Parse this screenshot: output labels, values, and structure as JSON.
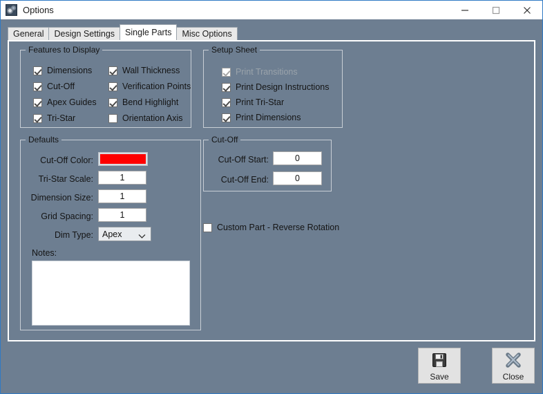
{
  "window": {
    "title": "Options",
    "icon": "gears-icon",
    "controls": {
      "minimize": "minimize-icon",
      "maximize": "maximize-icon",
      "close": "close-icon"
    }
  },
  "tabs": [
    {
      "label": "General",
      "active": false
    },
    {
      "label": "Design Settings",
      "active": false
    },
    {
      "label": "Single Parts",
      "active": true
    },
    {
      "label": "Misc Options",
      "active": false
    }
  ],
  "features_group": {
    "legend": "Features to Display",
    "items": [
      {
        "label": "Dimensions",
        "checked": true,
        "disabled": false
      },
      {
        "label": "Cut-Off",
        "checked": true,
        "disabled": false
      },
      {
        "label": "Apex Guides",
        "checked": true,
        "disabled": false
      },
      {
        "label": "Tri-Star",
        "checked": true,
        "disabled": false
      },
      {
        "label": "Wall Thickness",
        "checked": true,
        "disabled": false
      },
      {
        "label": "Verification Points",
        "checked": true,
        "disabled": false
      },
      {
        "label": "Bend Highlight",
        "checked": true,
        "disabled": false
      },
      {
        "label": "Orientation Axis",
        "checked": false,
        "disabled": false
      }
    ]
  },
  "setup_sheet_group": {
    "legend": "Setup Sheet",
    "items": [
      {
        "label": "Print Transitions",
        "checked": true,
        "disabled": true
      },
      {
        "label": "Print Design Instructions",
        "checked": true,
        "disabled": false
      },
      {
        "label": "Print Tri-Star",
        "checked": true,
        "disabled": false
      },
      {
        "label": "Print Dimensions",
        "checked": true,
        "disabled": false
      }
    ]
  },
  "defaults_group": {
    "legend": "Defaults",
    "cutoff_color_label": "Cut-Off Color:",
    "cutoff_color_value": "#FF0000",
    "tristar_scale_label": "Tri-Star Scale:",
    "tristar_scale_value": "1",
    "dimension_size_label": "Dimension Size:",
    "dimension_size_value": "1",
    "grid_spacing_label": "Grid Spacing:",
    "grid_spacing_value": "1",
    "dim_type_label": "Dim Type:",
    "dim_type_value": "Apex",
    "notes_label": "Notes:",
    "notes_value": ""
  },
  "cutoff_group": {
    "legend": "Cut-Off",
    "start_label": "Cut-Off Start:",
    "start_value": "0",
    "end_label": "Cut-Off End:",
    "end_value": "0"
  },
  "custom_part": {
    "label": "Custom Part - Reverse Rotation",
    "checked": false
  },
  "footer": {
    "save_label": "Save",
    "close_label": "Close"
  }
}
